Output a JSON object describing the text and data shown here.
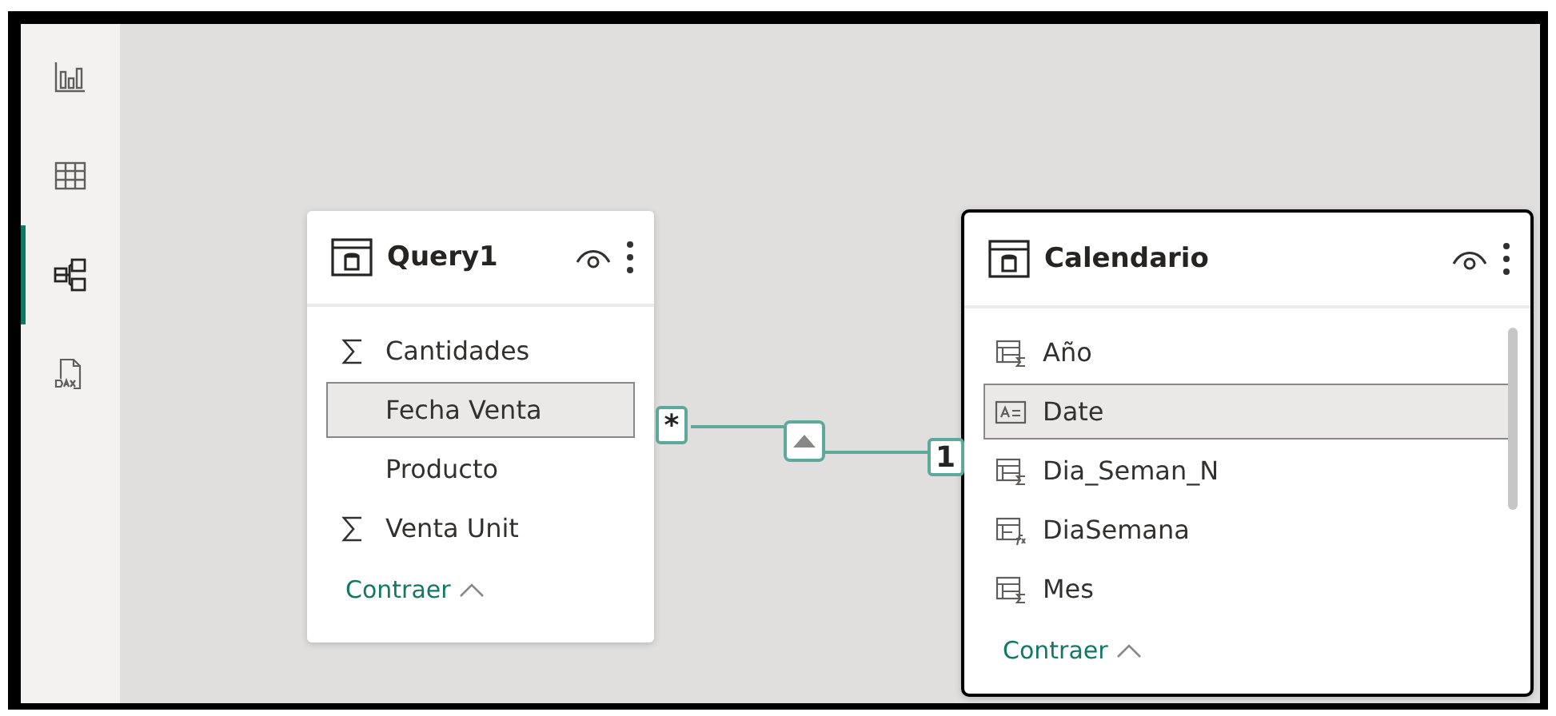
{
  "sidebar": {
    "items": [
      {
        "kind": "report",
        "selected": false
      },
      {
        "kind": "data",
        "selected": false
      },
      {
        "kind": "model",
        "selected": true
      },
      {
        "kind": "dax",
        "selected": false
      }
    ]
  },
  "tables": [
    {
      "name": "Query1",
      "selected": false,
      "scrollable": false,
      "collapse_label": "Contraer",
      "fields": [
        {
          "name": "Cantidades",
          "kind": "measure",
          "selected": false
        },
        {
          "name": "Fecha Venta",
          "kind": "plain",
          "selected": true
        },
        {
          "name": "Producto",
          "kind": "plain",
          "selected": false
        },
        {
          "name": "Venta Unit",
          "kind": "measure",
          "selected": false
        }
      ]
    },
    {
      "name": "Calendario",
      "selected": true,
      "scrollable": true,
      "collapse_label": "Contraer",
      "fields": [
        {
          "name": "Año",
          "kind": "numeric",
          "selected": false
        },
        {
          "name": "Date",
          "kind": "text",
          "selected": true
        },
        {
          "name": "Dia_Seman_N",
          "kind": "numeric",
          "selected": false
        },
        {
          "name": "DiaSemana",
          "kind": "calculated",
          "selected": false
        },
        {
          "name": "Mes",
          "kind": "numeric",
          "selected": false
        }
      ]
    }
  ],
  "relationship": {
    "from_cardinality": "*",
    "to_cardinality": "1"
  }
}
